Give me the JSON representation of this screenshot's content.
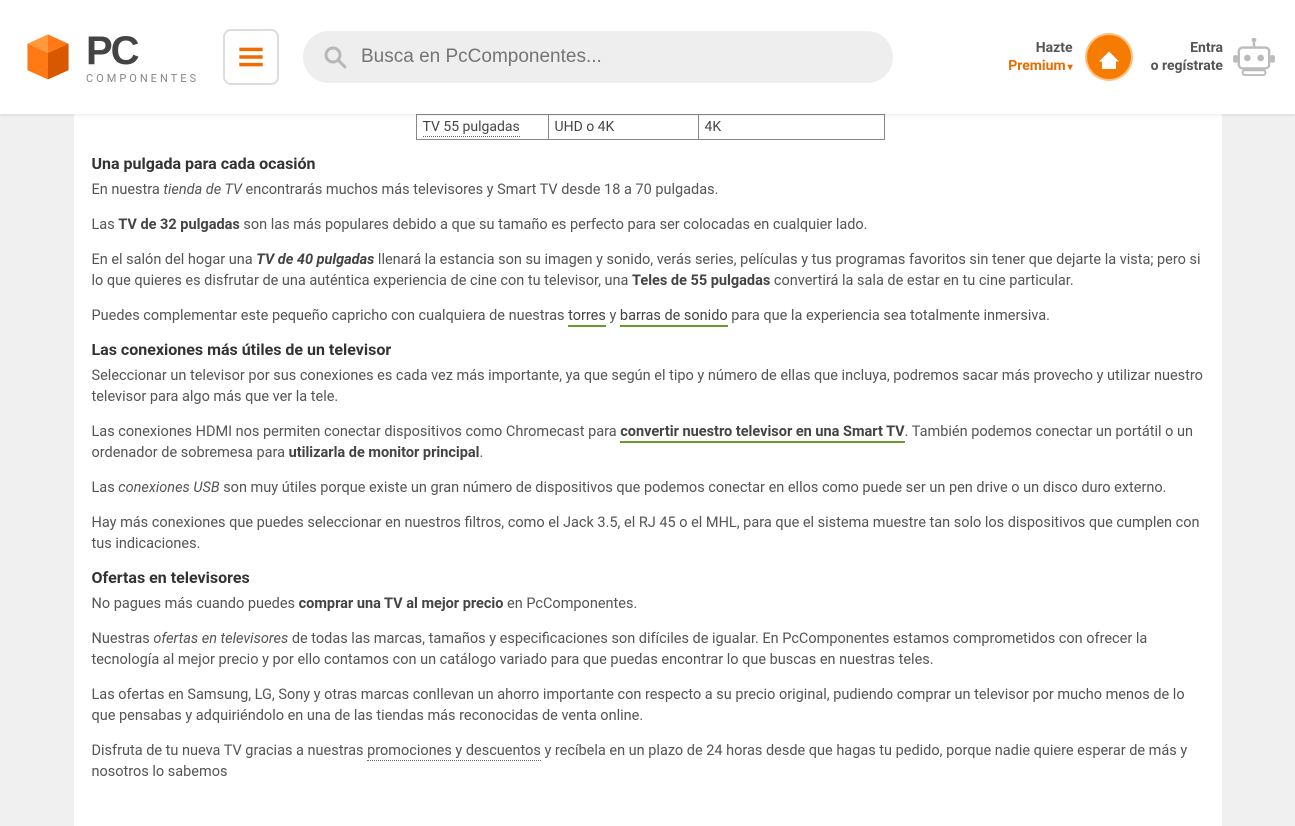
{
  "header": {
    "logo_brand": "PC",
    "logo_sub": "COMPONENTES",
    "search_placeholder": "Busca en PcComponentes...",
    "premium_l1": "Hazte",
    "premium_l2": "Premium",
    "login_l1": "Entra",
    "login_l2": "o regístrate"
  },
  "table": {
    "c1": "TV 55 pulgadas",
    "c2": "UHD o 4K",
    "c3": "4K"
  },
  "sections": {
    "pulgada": {
      "title": "Una pulgada para cada ocasión",
      "p1_a": "En nuestra ",
      "p1_i": "tienda de TV",
      "p1_b": " encontrarás muchos más televisores y Smart TV desde 18 a 70 pulgadas.",
      "p2_a": "Las ",
      "p2_b": "TV de 32 pulgadas",
      "p2_c": " son las más populares debido a que su tamaño es perfecto para ser colocadas en cualquier lado.",
      "p3_a": "En el salón del hogar una ",
      "p3_b": "TV de 40 pulgadas",
      "p3_c": " llenará la estancia son su imagen y sonido, verás series, películas y tus programas favoritos sin tener que dejarte la vista; pero si lo que quieres es disfrutar de una auténtica experiencia de cine con tu televisor, una ",
      "p3_d": "Teles de 55 pulgadas",
      "p3_e": " convertirá la sala de estar en tu cine particular.",
      "p4_a": "Puedes complementar este pequeño capricho con cualquiera de nuestras ",
      "p4_link1": "torres",
      "p4_b": " y ",
      "p4_link2": "barras de sonido",
      "p4_c": " para que la experiencia sea totalmente inmersiva."
    },
    "conex": {
      "title": "Las conexiones más útiles de un televisor",
      "p1": "Seleccionar un televisor por sus conexiones es cada vez más importante, ya que según el tipo y número de ellas que incluya, podremos sacar más provecho y utilizar nuestro televisor para algo más que ver la tele.",
      "p2_a": "Las conexiones HDMI nos permiten conectar dispositivos como Chromecast para ",
      "p2_link": "convertir nuestro televisor en una Smart TV",
      "p2_b": ". También podemos conectar un portátil o un ordenador de sobremesa para ",
      "p2_c": "utilizarla de monitor principal",
      "p2_d": ".",
      "p3_a": "Las ",
      "p3_i": "conexiones USB",
      "p3_b": " son muy útiles porque existe un gran número de dispositivos que podemos conectar en ellos como puede ser un pen drive o un disco duro externo.",
      "p4": "Hay más conexiones que puedes seleccionar en nuestros filtros, como el Jack 3.5, el RJ 45 o el MHL, para que el sistema muestre tan solo los dispositivos que cumplen con tus indicaciones."
    },
    "ofertas": {
      "title": "Ofertas en televisores",
      "p1_a": "No pagues más cuando puedes ",
      "p1_b": "comprar una TV al mejor precio",
      "p1_c": " en PcComponentes.",
      "p2_a": "Nuestras ",
      "p2_i": "ofertas en televisores",
      "p2_b": " de todas las marcas, tamaños y especificaciones son difíciles de igualar. En PcComponentes estamos comprometidos con ofrecer la tecnología al mejor precio y por ello contamos con un catálogo variado para que puedas encontrar lo que buscas en nuestras teles.",
      "p3": "Las ofertas en Samsung, LG, Sony y otras marcas conllevan un ahorro importante con respecto a su precio original, pudiendo comprar un televisor por mucho menos de lo que pensabas y adquiriéndolo en una de las tiendas más reconocidas de venta online.",
      "p4_a": "Disfruta de tu nueva TV gracias a nuestras ",
      "p4_link": "promociones y descuentos",
      "p4_b": " y recíbela en un plazo de 24 horas desde que hagas tu pedido, porque nadie quiere esperar de más y nosotros lo sabemos"
    }
  }
}
